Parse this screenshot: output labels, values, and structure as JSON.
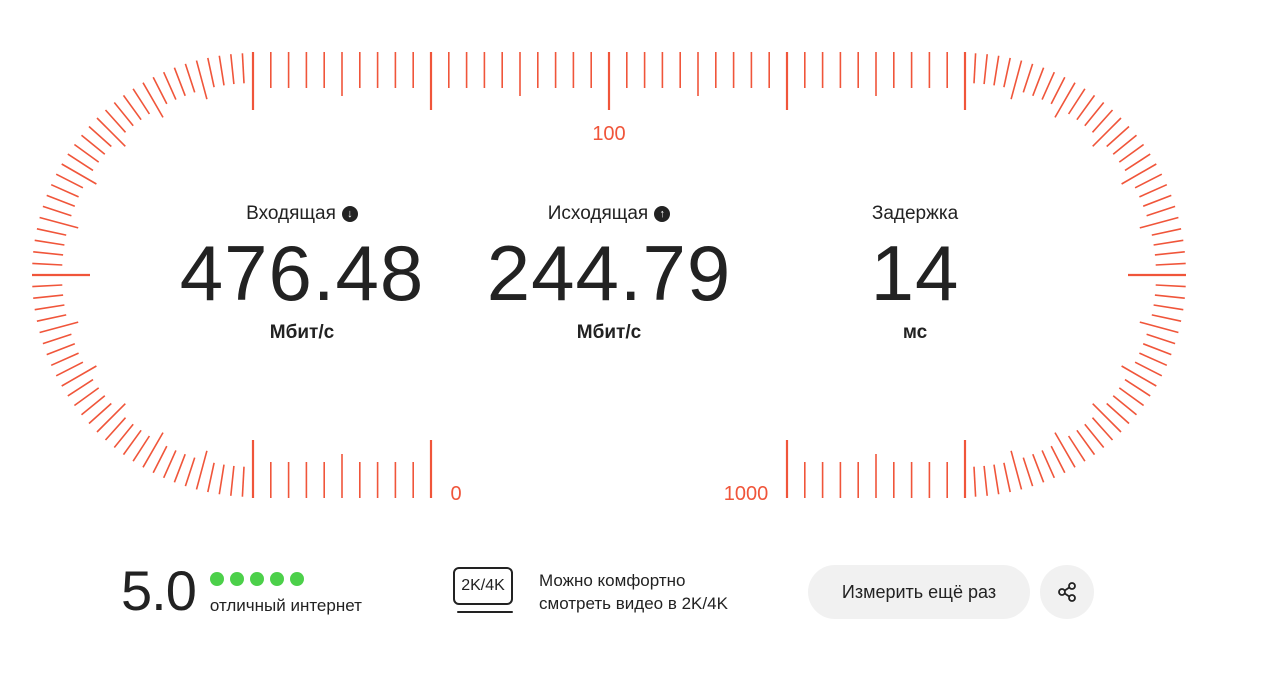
{
  "gauge": {
    "accent_color": "#f0553a",
    "labels": {
      "top": "100",
      "bottom_left": "0",
      "bottom_right": "1000"
    }
  },
  "metrics": {
    "download": {
      "label": "Входящая",
      "icon": "arrow-down-circle-icon",
      "value": "476.48",
      "unit": "Мбит/с"
    },
    "upload": {
      "label": "Исходящая",
      "icon": "arrow-up-circle-icon",
      "value": "244.79",
      "unit": "Мбит/с"
    },
    "ping": {
      "label": "Задержка",
      "value": "14",
      "unit": "мс"
    }
  },
  "score": {
    "value": "5.0",
    "stars_filled": 5,
    "stars_total": 5,
    "dot_color": "#4cd04a",
    "text": "отличный интернет"
  },
  "video": {
    "badge": "2K/4K",
    "line1": "Можно комфортно",
    "line2": "смотреть видео в 2K/4K"
  },
  "actions": {
    "retry_label": "Измерить ещё раз",
    "share_icon": "share-icon"
  }
}
